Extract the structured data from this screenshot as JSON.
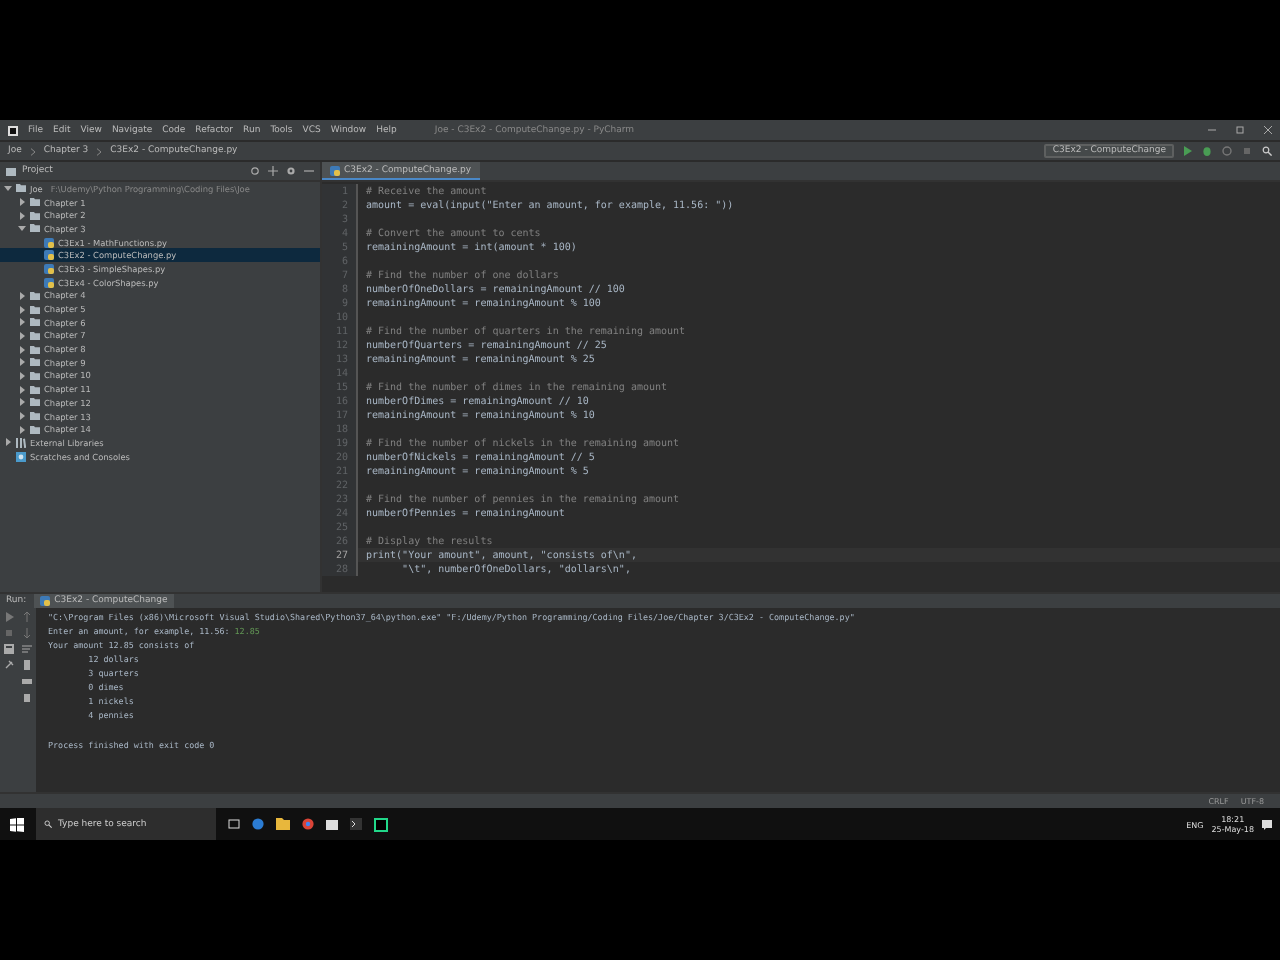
{
  "window": {
    "title": "Joe - C3Ex2 - ComputeChange.py - PyCharm"
  },
  "menu": [
    "File",
    "Edit",
    "View",
    "Navigate",
    "Code",
    "Refactor",
    "Run",
    "Tools",
    "VCS",
    "Window",
    "Help"
  ],
  "breadcrumbs": [
    "Joe",
    "Chapter 3",
    "C3Ex2 - ComputeChange.py"
  ],
  "run_config": "C3Ex2 - ComputeChange",
  "project": {
    "title": "Project",
    "tree": [
      {
        "label": "Joe",
        "path": "F:\\Udemy\\Python Programming\\Coding Files\\Joe",
        "kind": "folder",
        "expanded": true,
        "selected": false,
        "children": [
          {
            "label": "Chapter 1",
            "kind": "folder",
            "expanded": false,
            "selected": false
          },
          {
            "label": "Chapter 2",
            "kind": "folder",
            "expanded": false,
            "selected": false
          },
          {
            "label": "Chapter 3",
            "kind": "folder",
            "expanded": true,
            "selected": false,
            "children": [
              {
                "label": "C3Ex1 - MathFunctions.py",
                "kind": "file",
                "selected": false
              },
              {
                "label": "C3Ex2 - ComputeChange.py",
                "kind": "file",
                "selected": true
              },
              {
                "label": "C3Ex3 - SimpleShapes.py",
                "kind": "file",
                "selected": false
              },
              {
                "label": "C3Ex4 - ColorShapes.py",
                "kind": "file",
                "selected": false
              }
            ]
          },
          {
            "label": "Chapter 4",
            "kind": "folder",
            "expanded": false,
            "selected": false
          },
          {
            "label": "Chapter 5",
            "kind": "folder",
            "expanded": false,
            "selected": false
          },
          {
            "label": "Chapter 6",
            "kind": "folder",
            "expanded": false,
            "selected": false
          },
          {
            "label": "Chapter 7",
            "kind": "folder",
            "expanded": false,
            "selected": false
          },
          {
            "label": "Chapter 8",
            "kind": "folder",
            "expanded": false,
            "selected": false
          },
          {
            "label": "Chapter 9",
            "kind": "folder",
            "expanded": false,
            "selected": false
          },
          {
            "label": "Chapter 10",
            "kind": "folder",
            "expanded": false,
            "selected": false
          },
          {
            "label": "Chapter 11",
            "kind": "folder",
            "expanded": false,
            "selected": false
          },
          {
            "label": "Chapter 12",
            "kind": "folder",
            "expanded": false,
            "selected": false
          },
          {
            "label": "Chapter 13",
            "kind": "folder",
            "expanded": false,
            "selected": false
          },
          {
            "label": "Chapter 14",
            "kind": "folder",
            "expanded": false,
            "selected": false
          }
        ]
      },
      {
        "label": "External Libraries",
        "kind": "library",
        "expanded": false,
        "selected": false
      },
      {
        "label": "Scratches and Consoles",
        "kind": "scratch",
        "selected": false
      }
    ]
  },
  "editor": {
    "tab": "C3Ex2 - ComputeChange.py",
    "lines": [
      {
        "n": "1",
        "kind": "comment",
        "text": "# Receive the amount",
        "current": false
      },
      {
        "n": "2",
        "kind": "code",
        "text": "amount = eval(input(\"Enter an amount, for example, 11.56: \"))",
        "current": false
      },
      {
        "n": "3",
        "kind": "blank",
        "current": false
      },
      {
        "n": "4",
        "kind": "comment",
        "text": "# Convert the amount to cents",
        "current": false
      },
      {
        "n": "5",
        "kind": "code",
        "text": "remainingAmount = int(amount * 100)",
        "current": false
      },
      {
        "n": "6",
        "kind": "blank",
        "current": false
      },
      {
        "n": "7",
        "kind": "comment",
        "text": "# Find the number of one dollars",
        "current": false
      },
      {
        "n": "8",
        "kind": "code",
        "text": "numberOfOneDollars = remainingAmount // 100",
        "current": false
      },
      {
        "n": "9",
        "kind": "code",
        "text": "remainingAmount = remainingAmount % 100",
        "current": false
      },
      {
        "n": "10",
        "kind": "blank",
        "current": false
      },
      {
        "n": "11",
        "kind": "comment",
        "text": "# Find the number of quarters in the remaining amount",
        "current": false
      },
      {
        "n": "12",
        "kind": "code",
        "text": "numberOfQuarters = remainingAmount // 25",
        "current": false
      },
      {
        "n": "13",
        "kind": "code",
        "text": "remainingAmount = remainingAmount % 25",
        "current": false
      },
      {
        "n": "14",
        "kind": "blank",
        "current": false
      },
      {
        "n": "15",
        "kind": "comment",
        "text": "# Find the number of dimes in the remaining amount",
        "current": false
      },
      {
        "n": "16",
        "kind": "code",
        "text": "numberOfDimes = remainingAmount // 10",
        "current": false
      },
      {
        "n": "17",
        "kind": "code",
        "text": "remainingAmount = remainingAmount % 10",
        "current": false
      },
      {
        "n": "18",
        "kind": "blank",
        "current": false
      },
      {
        "n": "19",
        "kind": "comment",
        "text": "# Find the number of nickels in the remaining amount",
        "current": false
      },
      {
        "n": "20",
        "kind": "code",
        "text": "numberOfNickels = remainingAmount // 5",
        "current": false
      },
      {
        "n": "21",
        "kind": "code",
        "text": "remainingAmount = remainingAmount % 5",
        "current": false
      },
      {
        "n": "22",
        "kind": "blank",
        "current": false
      },
      {
        "n": "23",
        "kind": "comment",
        "text": "# Find the number of pennies in the remaining amount",
        "current": false
      },
      {
        "n": "24",
        "kind": "code",
        "text": "numberOfPennies = remainingAmount",
        "current": false
      },
      {
        "n": "25",
        "kind": "blank",
        "current": false
      },
      {
        "n": "26",
        "kind": "comment",
        "text": "# Display the results",
        "current": false
      },
      {
        "n": "27",
        "kind": "code",
        "text": "print(\"Your amount\", amount, \"consists of\\n\",",
        "current": true
      },
      {
        "n": "28",
        "kind": "code",
        "text": "      \"\\t\", numberOfOneDollars, \"dollars\\n\",",
        "current": false
      }
    ]
  },
  "run": {
    "label": "Run:",
    "tab": "C3Ex2 - ComputeChange",
    "console": [
      {
        "text": "\"C:\\Program Files (x86)\\Microsoft Visual Studio\\Shared\\Python37_64\\python.exe\" \"F:/Udemy/Python Programming/Coding Files/Joe/Chapter 3/C3Ex2 - ComputeChange.py\""
      },
      {
        "text": "Enter an amount, for example, 11.56: ",
        "input": "12.85"
      },
      {
        "text": "Your amount 12.85 consists of"
      },
      {
        "text": "\t12 dollars"
      },
      {
        "text": "\t3 quarters"
      },
      {
        "text": "\t0 dimes"
      },
      {
        "text": "\t1 nickels"
      },
      {
        "text": "\t4 pennies"
      },
      {
        "kind": "blank"
      },
      {
        "text": "Process finished with exit code 0"
      }
    ]
  },
  "status_bar": [
    "CRLF",
    "UTF-8"
  ],
  "taskbar": {
    "search": "Type here to search",
    "language": "ENG",
    "time": "18:21",
    "date": "25-May-18"
  }
}
